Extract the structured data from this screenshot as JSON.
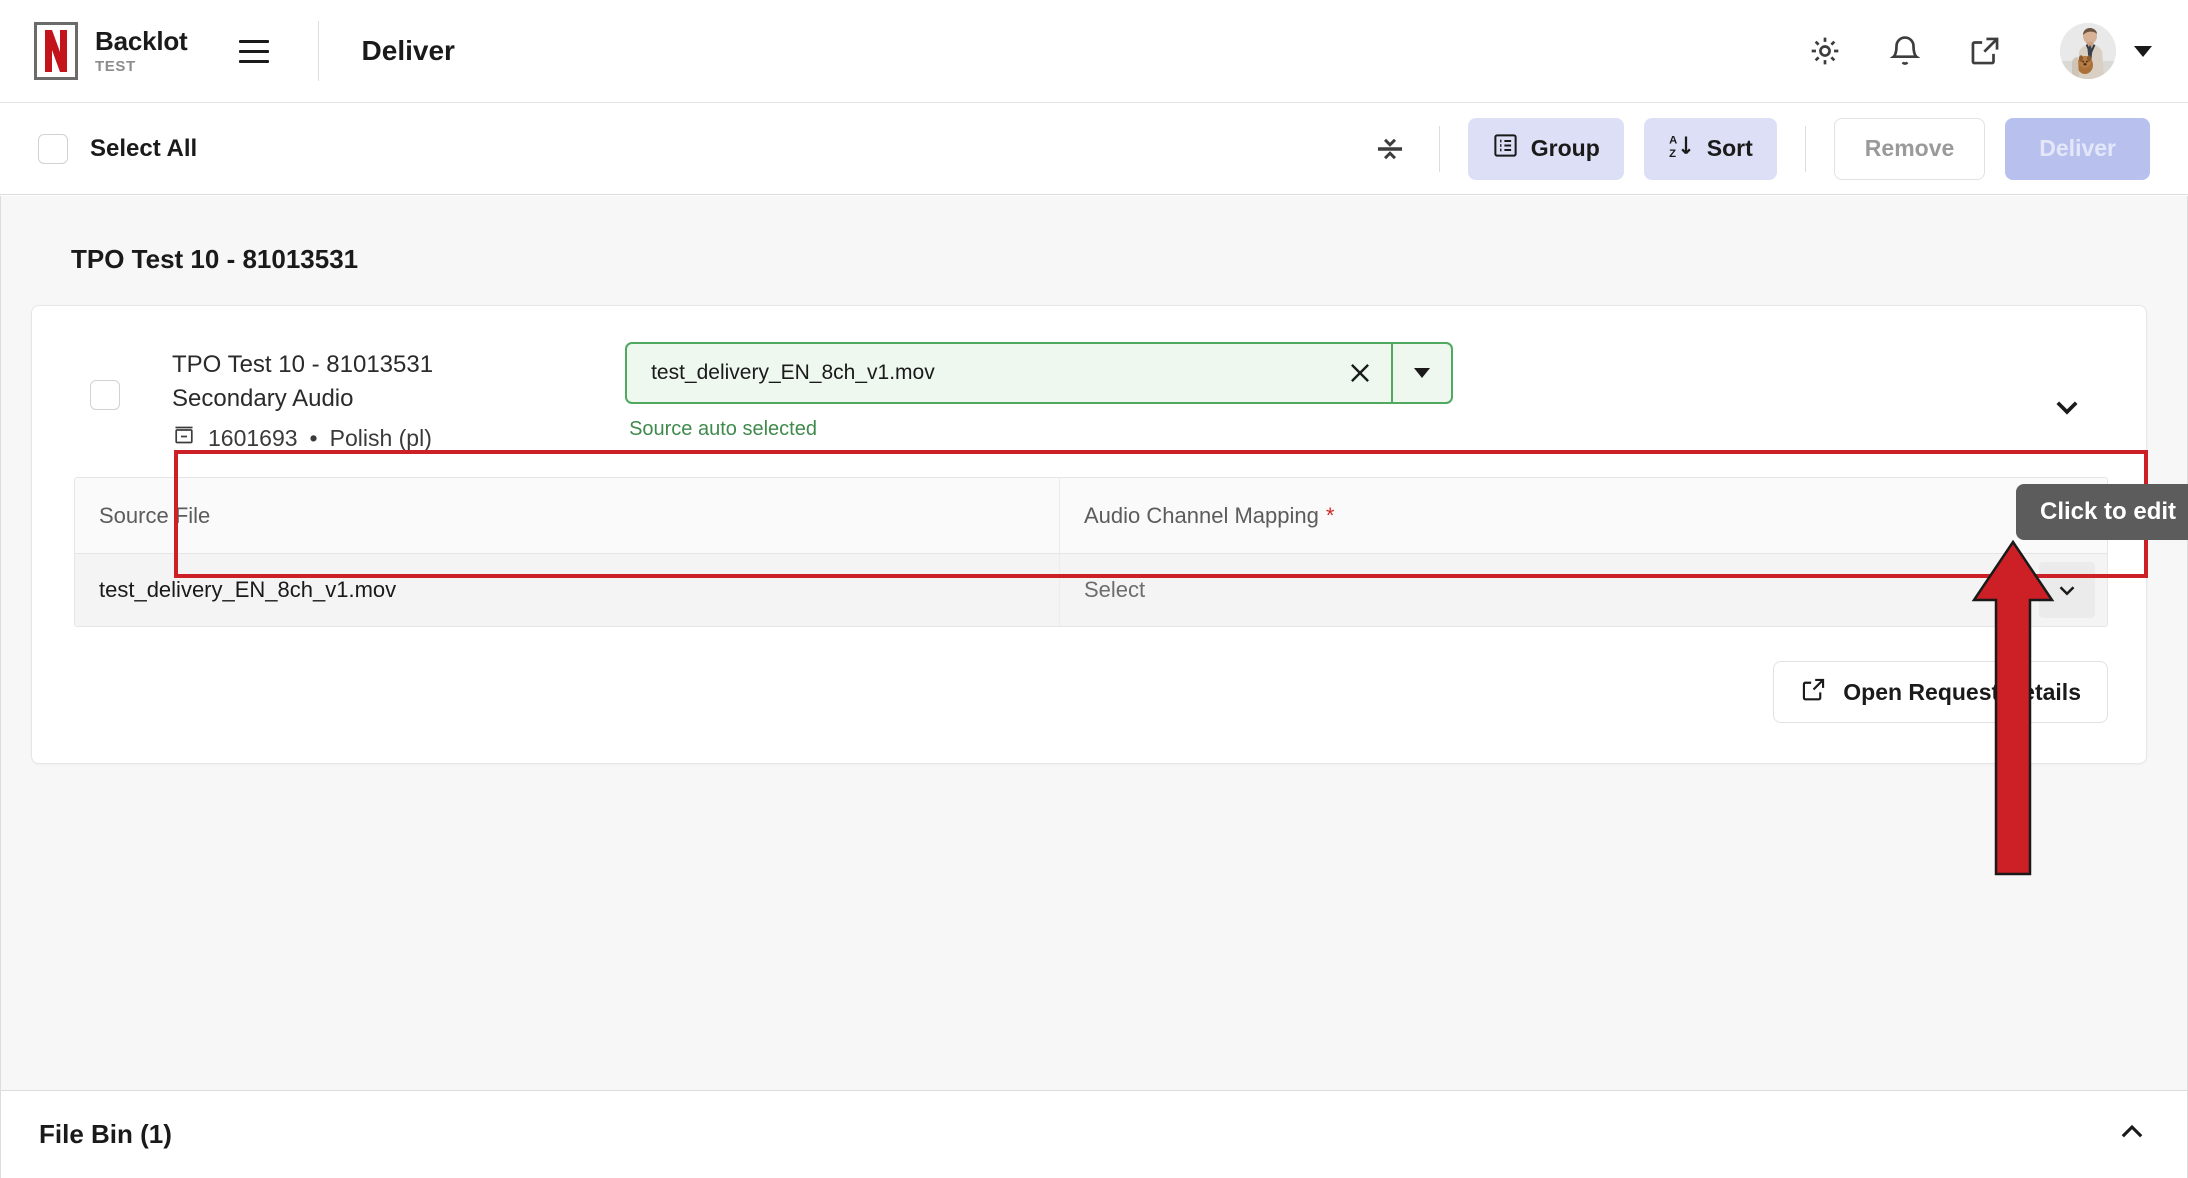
{
  "header": {
    "brand_name": "Backlot",
    "brand_env": "TEST",
    "page_title": "Deliver",
    "icons": {
      "menu": "hamburger-menu-icon",
      "settings": "gear-icon",
      "notifications": "bell-icon",
      "external": "external-link-icon",
      "avatar": "user-avatar",
      "caret": "chevron-down-icon"
    }
  },
  "toolbar": {
    "select_all_label": "Select All",
    "collapse_all_icon": "collapse-all-icon",
    "group_label": "Group",
    "sort_label": "Sort",
    "remove_label": "Remove",
    "deliver_label": "Deliver",
    "deliver_disabled": true
  },
  "main": {
    "group_heading": "TPO Test 10 - 81013531",
    "asset": {
      "title": "TPO Test 10 - 81013531",
      "subtitle": "Secondary Audio",
      "id": "1601693",
      "separator": "•",
      "language": "Polish (pl)"
    },
    "source_select": {
      "value": "test_delivery_EN_8ch_v1.mov",
      "helper_text": "Source auto selected",
      "clear_icon": "close-icon",
      "dropdown_icon": "caret-down-icon",
      "border_color": "#4fa95e",
      "fill_color": "#eef8ef",
      "helper_color": "#3f8a4c"
    },
    "table": {
      "columns": [
        "Source File",
        "Audio Channel Mapping"
      ],
      "required_marker": "*",
      "required_color": "#d12a2a",
      "rows": [
        {
          "source_file": "test_delivery_EN_8ch_v1.mov",
          "audio_channel_mapping": "Select"
        }
      ]
    },
    "open_request_details_label": "Open Request Details"
  },
  "footer": {
    "title": "File Bin (1)",
    "collapse_icon": "chevron-up-icon"
  },
  "annotations": {
    "tooltip_text": "Click to edit",
    "tooltip_bg": "#5c5c5c",
    "highlight_color": "#cc2026",
    "arrow_color": "#cc2026"
  }
}
